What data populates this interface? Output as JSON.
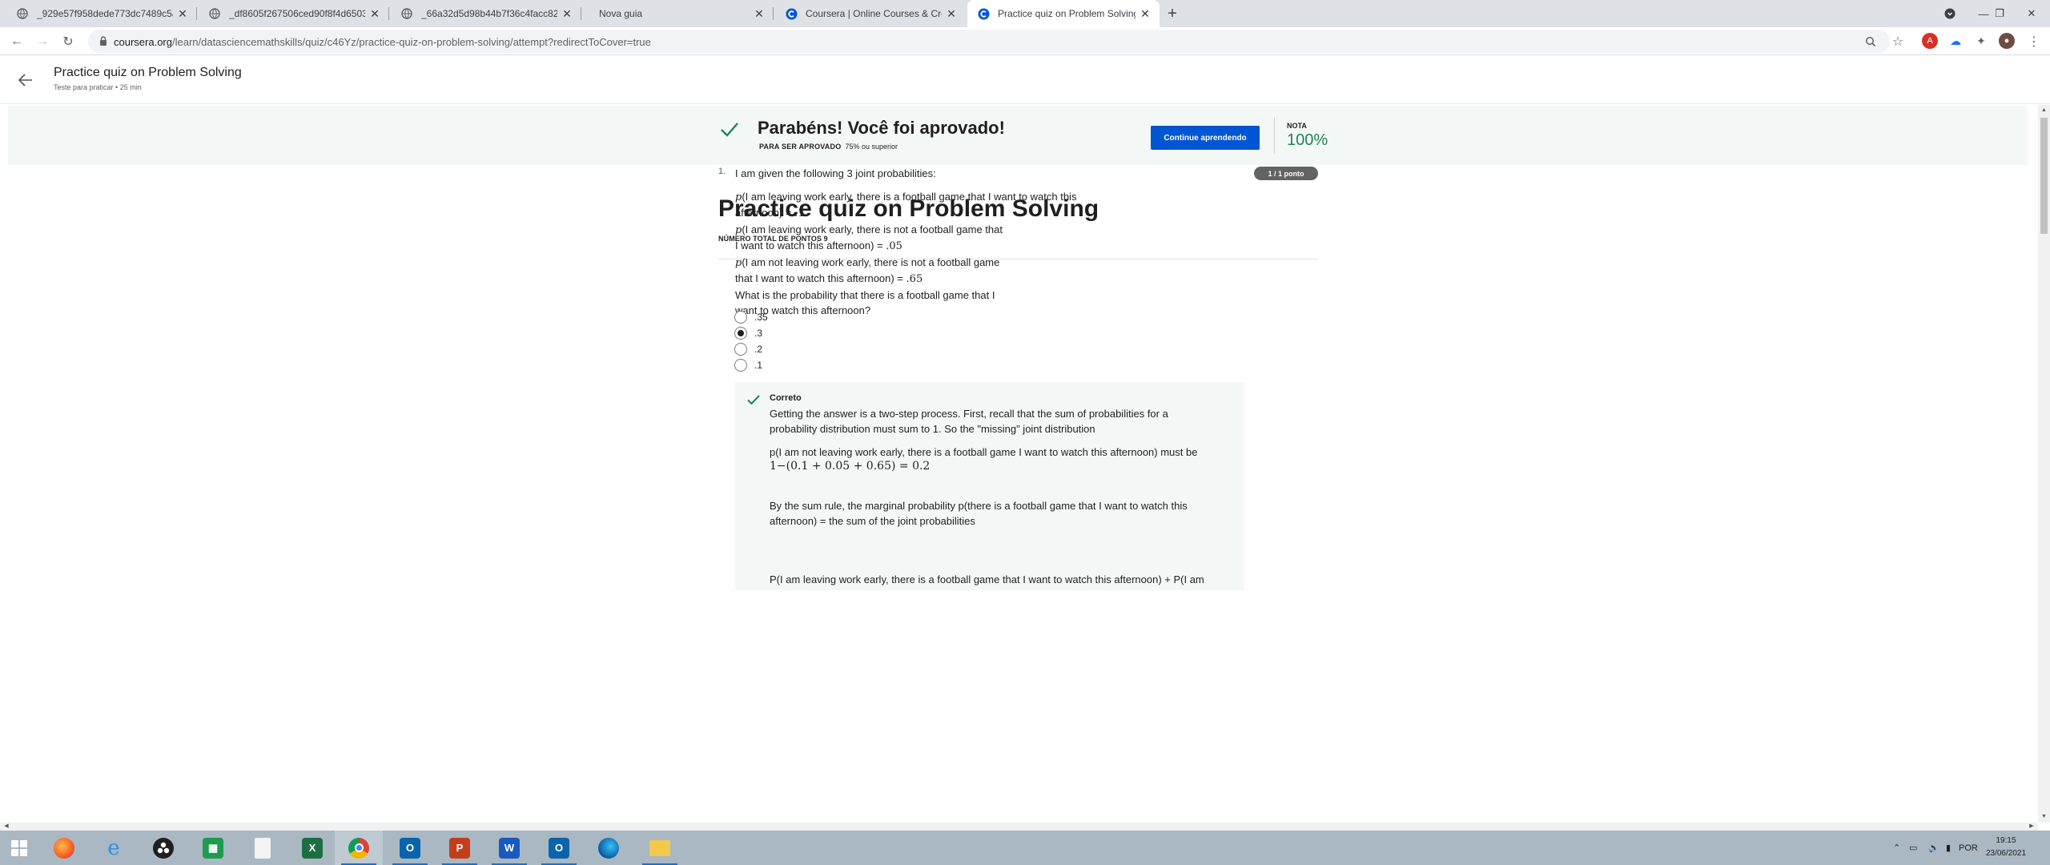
{
  "browser": {
    "tabs": [
      {
        "title": "_929e57f958dede773dc7489c5a...",
        "favicon": "globe-icon",
        "active": false
      },
      {
        "title": "_df8605f267506ced90f8f4d6503...",
        "favicon": "globe-icon",
        "active": false
      },
      {
        "title": "_66a32d5d98b44b7f36c4facc82...",
        "favicon": "globe-icon",
        "active": false
      },
      {
        "title": "Nova guia",
        "favicon": "none",
        "active": false
      },
      {
        "title": "Coursera | Online Courses & Cre...",
        "favicon": "coursera-icon",
        "active": false
      },
      {
        "title": "Practice quiz on Problem Solving",
        "favicon": "coursera-icon",
        "active": true
      }
    ],
    "url_host": "coursera.org",
    "url_path": "/learn/datasciencemathskills/quiz/c46Yz/practice-quiz-on-problem-solving/attempt?redirectToCover=true"
  },
  "header": {
    "title": "Practice quiz on Problem Solving",
    "subtitle": "Teste para praticar • 25 min"
  },
  "banner": {
    "message": "Parabéns! Você foi aprovado!",
    "pass_label": "PARA SER APROVADO",
    "pass_value": "75% ou superior",
    "continue_label": "Continue aprendendo",
    "grade_label": "NOTA",
    "grade_value": "100%"
  },
  "quiz": {
    "title": "Practice quiz on Problem Solving",
    "total_points": "NÚMERO TOTAL DE PONTOS 9",
    "question": {
      "number": "1.",
      "points": "1 / 1 ponto",
      "intro": "I am given the following 3 joint probabilities:",
      "p1a": "(I am leaving work early, there is a football game that I want to watch this",
      "p1b": "afternoon) = ",
      "p1v": ".1",
      "p2a": "(I am leaving work early, there is not a football game that",
      "p2b": "I want to watch this afternoon) = ",
      "p2v": ".05",
      "p3a": "(I am not leaving work early, there is not a football game",
      "p3b": "that I want to watch this afternoon) = ",
      "p3v": ".65",
      "p_symbol": "p",
      "ask_a": "What is the probability that there is a football game that I",
      "ask_b": "want to watch this afternoon?",
      "options": [
        {
          "label": ".35",
          "selected": false
        },
        {
          "label": ".3",
          "selected": true
        },
        {
          "label": ".2",
          "selected": false
        },
        {
          "label": ".1",
          "selected": false
        }
      ]
    },
    "feedback": {
      "label": "Correto",
      "t1a": "Getting the answer is a two-step process. First, recall that the sum of probabilities for a",
      "t1b": "probability distribution must sum to 1. So the \"missing\" joint distribution",
      "t2": "p(I am not leaving work early, there is a football game I want to watch this afternoon) must be",
      "t2math": "1−(0.1 + 0.05 + 0.65) = 0.2",
      "t3a": "By the sum rule, the marginal probability p(there is a football game that I want to watch this",
      "t3b": "afternoon) = the sum of the joint probabilities",
      "t4": "P(I am leaving work early, there is a football game that I want to watch this afternoon) + P(I am"
    }
  },
  "taskbar": {
    "apps": [
      "firefox-icon",
      "internet-explorer-icon",
      "obs-icon",
      "spreadsheet-icon",
      "file-icon",
      "excel-icon",
      "chrome-icon",
      "outlook-icon",
      "powerpoint-icon",
      "word-icon",
      "outlook-icon",
      "edge-icon",
      "file-explorer-icon"
    ],
    "language": "POR",
    "time": "19:15",
    "date": "23/06/2021"
  }
}
